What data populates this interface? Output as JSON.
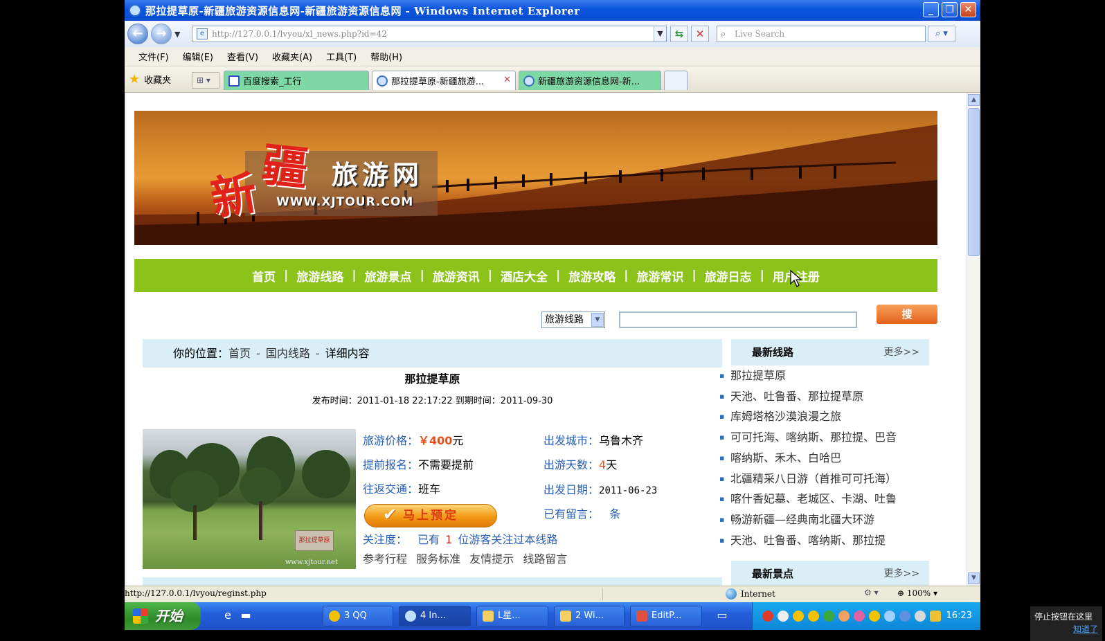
{
  "window": {
    "title": "那拉提草原-新疆旅游资源信息网-新疆旅游资源信息网 - Windows Internet Explorer"
  },
  "toolbar": {
    "url": "http://127.0.0.1/lvyou/xl_news.php?id=42",
    "search_placeholder": "Live Search"
  },
  "menu": [
    "文件(F)",
    "编辑(E)",
    "查看(V)",
    "收藏夹(A)",
    "工具(T)",
    "帮助(H)"
  ],
  "favorites_label": "收藏夹",
  "tabs": [
    {
      "label": "百度搜索_工行"
    },
    {
      "label": "那拉提草原-新疆旅游..."
    },
    {
      "label": "新疆旅游资源信息网-新..."
    }
  ],
  "banner": {
    "char1": "新",
    "char2": "疆",
    "name": "旅游网",
    "site": "WWW.XJTOUR.COM"
  },
  "nav": [
    "首页",
    "旅游线路",
    "旅游景点",
    "旅游资讯",
    "酒店大全",
    "旅游攻略",
    "旅游常识",
    "旅游日志",
    "用户注册"
  ],
  "nav_separator": "|",
  "search": {
    "category": "旅游线路",
    "button": "搜 索"
  },
  "breadcrumb": {
    "prefix": "你的位置：",
    "home": "首页",
    "category": "国内线路",
    "current": "详细内容",
    "separator": "-"
  },
  "article": {
    "title": "那拉提草原",
    "meta": "发布时间：2011-01-18 22:17:22 到期时间：2011-09-30",
    "photo_stone": "那拉提草原",
    "photo_watermark": "www.xjtour.net",
    "price_label": "旅游价格：",
    "price": "￥400",
    "price_unit": "元",
    "city_label": "出发城市：",
    "city": "乌鲁木齐",
    "advance_label": "提前报名：",
    "advance": "不需要提前",
    "days_label": "出游天数：",
    "days": "4",
    "days_unit": "天",
    "transport_label": "往返交通：",
    "transport": "班车",
    "date_label": "出发日期：",
    "date": "2011-06-23",
    "book_button": "马上预定",
    "comments_label": "已有留言：",
    "comments_unit": "条",
    "attention_label": "关注度：",
    "attention_pre": "已有",
    "attention_count": "1",
    "attention_post": "位游客关注过本线路",
    "sublinks": [
      "参考行程",
      "服务标准",
      "友情提示",
      "线路留言"
    ]
  },
  "sidebar": {
    "latest_routes_title": "最新线路",
    "more": "更多>>",
    "routes": [
      "那拉提草原",
      "天池、吐鲁番、那拉提草原",
      "库姆塔格沙漠浪漫之旅",
      "可可托海、喀纳斯、那拉提、巴音",
      "喀纳斯、禾木、白哈巴",
      "北疆精采八日游（首推可可托海）",
      "喀什香妃墓、老城区、卡湖、吐鲁",
      "畅游新疆—经典南北疆大环游",
      "天池、吐鲁番、喀纳斯、那拉提"
    ],
    "latest_spots_title": "最新景点"
  },
  "statusbar": {
    "url": "http://127.0.0.1/lvyou/reginst.php",
    "zone": "Internet",
    "zoom": "100%"
  },
  "taskbar": {
    "start": "开始",
    "items": [
      "3 QQ",
      "4 In...",
      "L星...",
      "2 Wi...",
      "EditP..."
    ],
    "clock": "16:23"
  },
  "tooltip": {
    "line1": "停止按钮在这里",
    "link": "知道了"
  },
  "colors": {
    "nav_green": "#8cc31a",
    "link_blue": "#2760b8",
    "price_orange": "#e5501a",
    "panel_blue": "#d9eef7"
  }
}
